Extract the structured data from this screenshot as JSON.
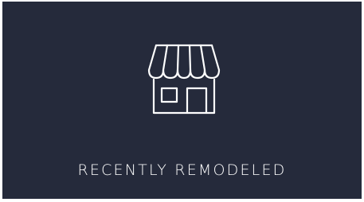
{
  "feature_card": {
    "icon": "storefront-icon",
    "label": "RECENTLY REMODELED",
    "colors": {
      "background": "#252a3b",
      "foreground": "#ffffff"
    }
  }
}
